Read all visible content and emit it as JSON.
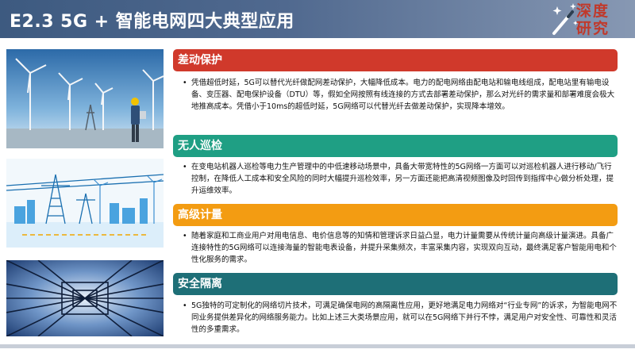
{
  "header": {
    "title": "E2.3  5G + 智能电网四大典型应用",
    "logo_text": "深度研究"
  },
  "sections": [
    {
      "title": "差动保护",
      "color": "#d0392b",
      "body": "凭借超低时延，5G可以替代光纤做配网差动保护，大幅降低成本。电力的配电网络由配电站和输电线组成，配电站里有输电设备、变压器、配电保护设备（DTU）等，假如全网按照有线连接的方式去部署差动保护，那么对光纤的需求量和部署难度会极大地推高成本。凭借小于10ms的超低时延，5G网络可以代替光纤去做差动保护，实现降本增效。"
    },
    {
      "title": "无人巡检",
      "color": "#1f9f84",
      "body": "在变电站机器人巡检等电力生产管理中的中低速移动场景中，具备大带宽特性的5G网络一方面可以对巡检机器人进行移动/飞行控制，在降低人工成本和安全风险的同时大幅提升巡检效率，另一方面还能把高清视频图像及时回传到指挥中心做分析处理，提升运维效率。"
    },
    {
      "title": "高级计量",
      "color": "#f39c12",
      "body": "随着家庭和工商业用户对用电信息、电价信息等的知情和管理诉求日益凸显，电力计量需要从传统计量向高级计量演进。具备广连接特性的5G网络可以连接海量的智能电表设备，并提升采集频次，丰富采集内容，实现双向互动，最终满足客户智能用电和个性化服务的需求。"
    },
    {
      "title": "安全隔离",
      "color": "#1e6f77",
      "body": "5G独特的可定制化的网络切片技术，可满足确保电网的高隔离性应用，更好地满足电力网络对“行业专网”的诉求，为智能电网不同业务提供差异化的网络服务能力。比如上述三大类场景应用，就可以在5G网络下并行不悖，满足用户对安全性、可靠性和灵活性的多重需求。"
    }
  ],
  "bullet_char": "•"
}
